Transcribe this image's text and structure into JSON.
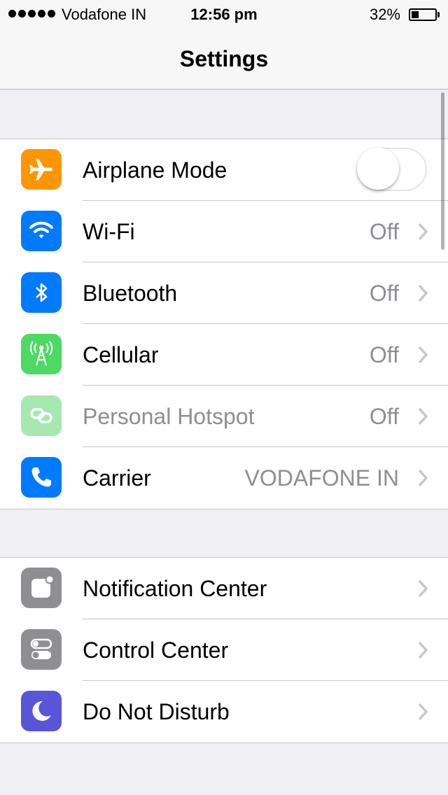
{
  "status_bar": {
    "carrier": "Vodafone IN",
    "time": "12:56 pm",
    "battery_percent": "32%",
    "battery_level": 0.32,
    "signal_bars": 5
  },
  "nav": {
    "title": "Settings"
  },
  "colors": {
    "airplane": "#ff9500",
    "wifi": "#007aff",
    "bluetooth": "#007aff",
    "cellular": "#4cd964",
    "hotspot": "#a6e8b0",
    "carrier": "#007aff",
    "notification": "#8e8e93",
    "control": "#8e8e93",
    "dnd": "#5856d6"
  },
  "group1": [
    {
      "label": "Airplane Mode",
      "icon": "airplane-icon",
      "toggle_on": false
    },
    {
      "label": "Wi-Fi",
      "value": "Off",
      "icon": "wifi-icon"
    },
    {
      "label": "Bluetooth",
      "value": "Off",
      "icon": "bluetooth-icon"
    },
    {
      "label": "Cellular",
      "value": "Off",
      "icon": "cellular-antenna-icon"
    },
    {
      "label": "Personal Hotspot",
      "value": "Off",
      "icon": "hotspot-icon"
    },
    {
      "label": "Carrier",
      "value": "VODAFONE IN",
      "icon": "phone-icon"
    }
  ],
  "group2": [
    {
      "label": "Notification Center",
      "icon": "notification-center-icon"
    },
    {
      "label": "Control Center",
      "icon": "control-center-icon"
    },
    {
      "label": "Do Not Disturb",
      "icon": "moon-icon"
    }
  ]
}
